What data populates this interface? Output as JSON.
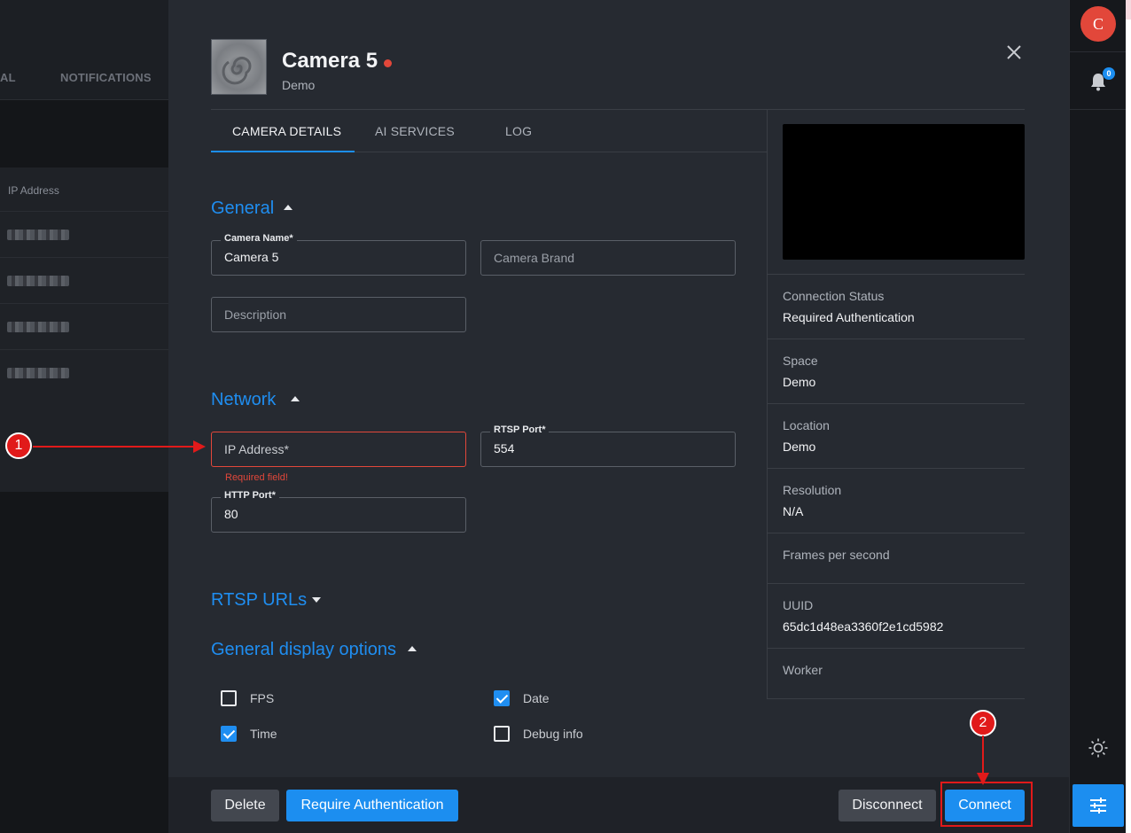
{
  "background": {
    "tabs": [
      "AL",
      "NOTIFICATIONS"
    ],
    "table_header": "IP Address"
  },
  "rail": {
    "avatar_letter": "C",
    "notification_count": "0"
  },
  "modal": {
    "title": "Camera 5",
    "subtitle": "Demo",
    "tabs": [
      {
        "label": "CAMERA DETAILS",
        "active": true
      },
      {
        "label": "AI SERVICES",
        "active": false
      },
      {
        "label": "LOG",
        "active": false
      }
    ],
    "sections": {
      "general": "General",
      "network": "Network",
      "rtsp_urls": "RTSP URLs",
      "display_options": "General display options"
    },
    "fields": {
      "camera_name": {
        "label": "Camera Name*",
        "value": "Camera 5"
      },
      "camera_brand": {
        "placeholder": "Camera Brand"
      },
      "description": {
        "placeholder": "Description"
      },
      "ip_address": {
        "placeholder": "IP Address*",
        "error": "Required field!"
      },
      "rtsp_port": {
        "label": "RTSP Port*",
        "value": "554"
      },
      "http_port": {
        "label": "HTTP Port*",
        "value": "80"
      }
    },
    "checkboxes": [
      {
        "label": "FPS",
        "checked": false
      },
      {
        "label": "Date",
        "checked": true
      },
      {
        "label": "Time",
        "checked": true
      },
      {
        "label": "Debug info",
        "checked": false
      }
    ],
    "info": [
      {
        "key": "Connection Status",
        "value": "Required Authentication"
      },
      {
        "key": "Space",
        "value": "Demo"
      },
      {
        "key": "Location",
        "value": "Demo"
      },
      {
        "key": "Resolution",
        "value": "N/A"
      },
      {
        "key": "Frames per second",
        "value": ""
      },
      {
        "key": "UUID",
        "value": "65dc1d48ea3360f2e1cd5982"
      },
      {
        "key": "Worker",
        "value": ""
      }
    ],
    "footer": {
      "delete": "Delete",
      "require_auth": "Require Authentication",
      "disconnect": "Disconnect",
      "connect": "Connect"
    }
  },
  "annotations": [
    "1",
    "2"
  ],
  "colors": {
    "accent": "#1c8ef0",
    "error": "#e2473a",
    "annotation": "#e11a1a",
    "modal_bg": "#262a31"
  }
}
